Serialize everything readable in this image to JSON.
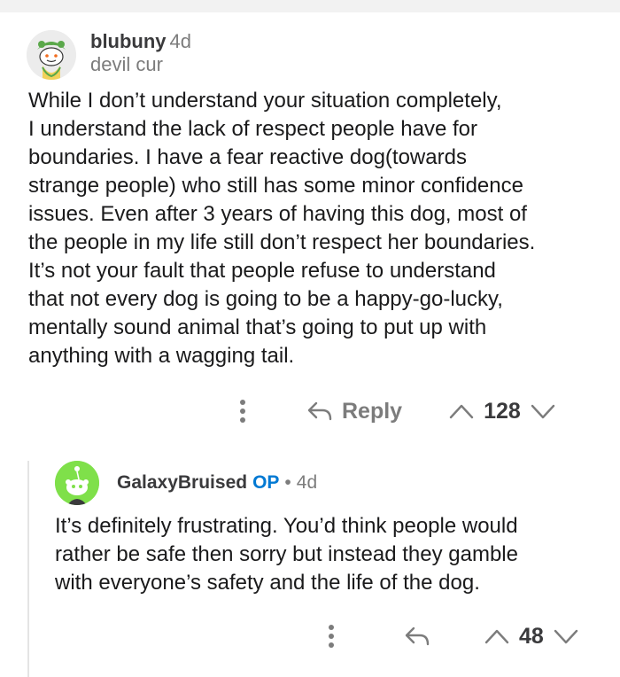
{
  "comment": {
    "author": "blubuny",
    "age": "4d",
    "flair": "devil cur",
    "lines": [
      "While I don’t understand your situation completely,",
      "I understand the lack of respect people have for",
      "boundaries. I have a fear reactive dog(towards",
      "strange people) who still has some minor confidence",
      "issues. Even after 3 years of having this dog, most of",
      "the people in my life still don’t respect her boundaries.",
      "It’s not your fault that people refuse to understand",
      "that not every dog is going to be a happy-go-lucky,",
      "mentally sound animal that’s going to put up with",
      "anything with a wagging tail."
    ],
    "reply_label": "Reply",
    "votes": "128"
  },
  "reply": {
    "author": "GalaxyBruised",
    "op_badge": "OP",
    "separator": "•",
    "age": "4d",
    "lines": [
      "It’s definitely frustrating. You’d think people would",
      "rather be safe then sorry but instead they gamble",
      "with everyone’s safety and the life of the dog."
    ],
    "votes": "48"
  },
  "colors": {
    "accent_op": "#0079d3",
    "meta_gray": "#7c7c7c",
    "text": "#1a1a1b",
    "reply_avatar_bg": "#7fe04a"
  },
  "icons": [
    "snoo-avatar",
    "more-options-icon",
    "reply-arrow-icon",
    "upvote-icon",
    "downvote-icon"
  ]
}
